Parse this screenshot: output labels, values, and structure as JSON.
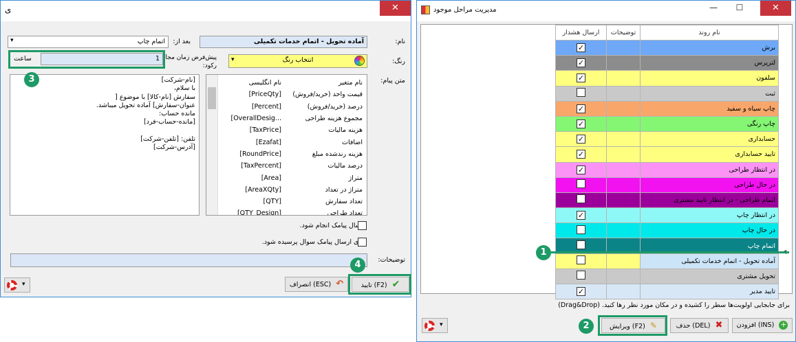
{
  "left_dialog": {
    "title_glyph": "ی",
    "close_glyph": "✕",
    "name_label": "نام:",
    "name_value": "آماده تحویل - اتمام خدمات تکمیلی",
    "after_label": "بعد از:",
    "after_value": "اتمام چاپ",
    "color_label": "رنگ:",
    "color_value": "انتخاب رنگ",
    "default_time_label": "پیش‌فرض زمان مجاز رکود:",
    "time_value": "1",
    "time_unit": "ساعت",
    "message_label": "متن پیام:",
    "message_lines": [
      "[نام-شرکت]",
      "با سلام،",
      "سفارش [نام-کالا] با موضوع [",
      "عنوان-سفارش] آماده تحویل میباشد.",
      "مانده حساب:",
      "[مانده-حساب-فرد]",
      "",
      "تلفن: [تلفن-شرکت]",
      "[آدرس-شرکت]"
    ],
    "variables_header": {
      "english": "نام انگلیسی",
      "variable": "نام متغیر"
    },
    "variables": [
      {
        "english": "[PriceQty]",
        "name": "قیمت واحد (خرید/فروش)"
      },
      {
        "english": "[Percent]",
        "name": "درصد (خرید/فروش)"
      },
      {
        "english": "[OverallDesig...",
        "name": "مجموع هزینه طراحی"
      },
      {
        "english": "[TaxPrice]",
        "name": "هزینه مالیات"
      },
      {
        "english": "[Ezafat]",
        "name": "اضافات"
      },
      {
        "english": "[RoundPrice]",
        "name": "هزینه رندشده مبلغ"
      },
      {
        "english": "[TaxPercent]",
        "name": "درصد مالیات"
      },
      {
        "english": "[Area]",
        "name": "متراژ"
      },
      {
        "english": "[AreaXQty]",
        "name": "متراژ در تعداد"
      },
      {
        "english": "[QTY]",
        "name": "تعداد سفارش"
      },
      {
        "english": "[QTY_Design]",
        "name": "تعداد طراحی"
      }
    ],
    "send_sms_label": "ارسال پیامک انجام شود.",
    "ask_sms_label": "برای ارسال پیامک سوال پرسیده شود.",
    "description_label": "توضیحات:",
    "confirm_label": "(F2) تایید",
    "cancel_label": "(ESC) انصراف"
  },
  "right_window": {
    "title": "مدیریت مراحل موجود",
    "columns": {
      "name": "نام روند",
      "desc": "توضیحات",
      "send_alert": "ارسال هشدار"
    },
    "rows": [
      {
        "name": "برش",
        "checked": true,
        "color": "#6ea8f7",
        "text_color": "#000"
      },
      {
        "name": "لترپرس",
        "checked": true,
        "color": "#8c8c8c",
        "text_color": "#000"
      },
      {
        "name": "سلفون",
        "checked": true,
        "color": "#ffff7f",
        "text_color": "#000"
      },
      {
        "name": "ثبت",
        "checked": false,
        "color": "#c9c9c9",
        "text_color": "#000"
      },
      {
        "name": "چاپ سیاه و سفید",
        "checked": true,
        "color": "#f9a66a",
        "text_color": "#000"
      },
      {
        "name": "چاپ رنگی",
        "checked": true,
        "color": "#85f574",
        "text_color": "#000"
      },
      {
        "name": "حسابداری",
        "checked": true,
        "color": "#ffff7f",
        "text_color": "#000"
      },
      {
        "name": "تایید حسابداری",
        "checked": true,
        "color": "#ffff7f",
        "text_color": "#000"
      },
      {
        "name": "در انتظار طراحی",
        "checked": true,
        "color": "#fa93f4",
        "text_color": "#000"
      },
      {
        "name": "در حال طراحی",
        "checked": false,
        "color": "#f212f0",
        "text_color": "#000"
      },
      {
        "name": "اتمام طراحی - در انتظار تایید مشتری",
        "checked": false,
        "color": "#9b009b",
        "text_color": "#000"
      },
      {
        "name": "در انتظار چاپ",
        "checked": true,
        "color": "#8ef8f6",
        "text_color": "#000"
      },
      {
        "name": "در حال چاپ",
        "checked": false,
        "color": "#00e9ea",
        "text_color": "#000"
      },
      {
        "name": "اتمام چاپ",
        "checked": false,
        "color": "#0b8487",
        "text_color": "#fff"
      },
      {
        "name": "آماده تحویل - اتمام خدمات تکمیلی",
        "checked": false,
        "color": "#ffff7f",
        "text_color": "#000",
        "selected": true
      },
      {
        "name": "تحویل مشتری",
        "checked": false,
        "color": "#c9c9c9",
        "text_color": "#000"
      },
      {
        "name": "تایید مدیر",
        "checked": true,
        "color": "#d7e7f6",
        "text_color": "#000"
      }
    ],
    "hint": "برای جابجایی اولویت‌ها سطر را کشیده و در مکان مورد نظر رها کنید. (Drag&Drop)",
    "add_label": "(INS) افزودن",
    "delete_label": "(DEL) حذف",
    "edit_label": "(F2) ویرایش"
  },
  "callouts": [
    "1",
    "2",
    "3",
    "4"
  ]
}
